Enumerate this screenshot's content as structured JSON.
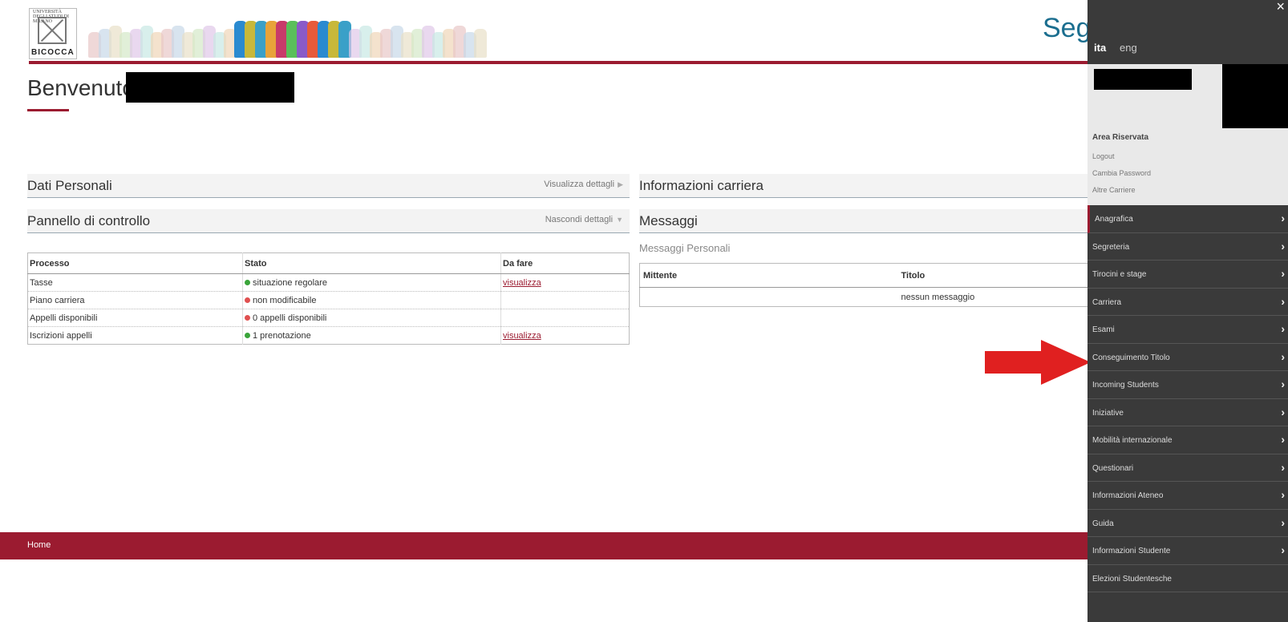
{
  "header": {
    "logo": {
      "top_text": "UNIVERSITÀ DEGLI STUDI DI MILANO",
      "text": "BICOCCA"
    },
    "brand_partial": "Segr"
  },
  "welcome": {
    "label": "Benvenuto"
  },
  "panels": {
    "dati_personali": {
      "title": "Dati Personali",
      "action": "Visualizza dettagli",
      "action_icon": "triangle-right-icon"
    },
    "pannello": {
      "title": "Pannello di controllo",
      "action": "Nascondi dettagli",
      "action_icon": "triangle-down-icon"
    },
    "informazioni_carriera": {
      "title": "Informazioni carriera"
    },
    "messaggi": {
      "title": "Messaggi",
      "subtitle": "Messaggi Personali"
    }
  },
  "process_table": {
    "headers": [
      "Processo",
      "Stato",
      "Da fare"
    ],
    "rows": [
      {
        "processo": "Tasse",
        "stato": "situazione regolare",
        "status": "green",
        "da_fare": "visualizza"
      },
      {
        "processo": "Piano carriera",
        "stato": "non modificabile",
        "status": "red",
        "da_fare": ""
      },
      {
        "processo": "Appelli disponibili",
        "stato": "0 appelli disponibili",
        "status": "red",
        "da_fare": ""
      },
      {
        "processo": "Iscrizioni appelli",
        "stato": "1 prenotazione",
        "status": "green",
        "da_fare": "visualizza"
      }
    ]
  },
  "messages_table": {
    "headers": [
      "Mittente",
      "Titolo"
    ],
    "empty_text": "nessun messaggio"
  },
  "footer": {
    "home": "Home"
  },
  "sidebar": {
    "close": "×",
    "lang": {
      "ita": "ita",
      "eng": "eng"
    },
    "area_title": "Area Riservata",
    "links": [
      "Logout",
      "Cambia Password",
      "Altre Carriere"
    ],
    "menu": [
      {
        "label": "Anagrafica",
        "chevron": true
      },
      {
        "label": "Segreteria",
        "chevron": true
      },
      {
        "label": "Tirocini e stage",
        "chevron": true
      },
      {
        "label": "Carriera",
        "chevron": true
      },
      {
        "label": "Esami",
        "chevron": true
      },
      {
        "label": "Conseguimento Titolo",
        "chevron": true
      },
      {
        "label": "Incoming Students",
        "chevron": true
      },
      {
        "label": "Iniziative",
        "chevron": true
      },
      {
        "label": "Mobilità internazionale",
        "chevron": true
      },
      {
        "label": "Questionari",
        "chevron": true
      },
      {
        "label": "Informazioni Ateneo",
        "chevron": true
      },
      {
        "label": "Guida",
        "chevron": true
      },
      {
        "label": "Informazioni Studente",
        "chevron": true
      },
      {
        "label": "Elezioni Studentesche",
        "chevron": false
      }
    ]
  },
  "colors": {
    "brand_red": "#9b1b30",
    "sidebar_bg": "#3a3a3a",
    "arrow_red": "#e02020"
  }
}
